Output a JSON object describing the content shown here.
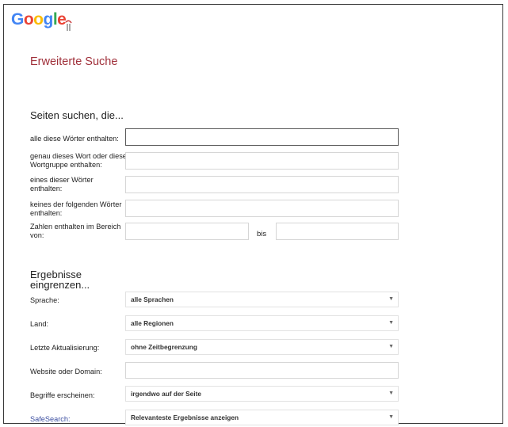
{
  "logo": {
    "text": "Google"
  },
  "page_title": "Erweiterte Suche",
  "find_pages": {
    "heading": "Seiten suchen, die...",
    "rows": [
      {
        "label": "alle diese Wörter enthalten:",
        "value": ""
      },
      {
        "label": "genau dieses Wort oder diese Wortgruppe enthalten:",
        "value": ""
      },
      {
        "label": "eines dieser Wörter enthalten:",
        "value": ""
      },
      {
        "label": "keines der folgenden Wörter enthalten:",
        "value": ""
      },
      {
        "label": "Zahlen enthalten im Bereich von:",
        "value_from": "",
        "value_to": ""
      }
    ],
    "range_separator": "bis"
  },
  "narrow": {
    "heading_line1": "Ergebnisse",
    "heading_line2": "eingrenzen...",
    "rows": [
      {
        "label": "Sprache:",
        "value": "alle Sprachen",
        "type": "select"
      },
      {
        "label": "Land:",
        "value": "alle Regionen",
        "type": "select"
      },
      {
        "label": "Letzte Aktualisierung:",
        "value": "ohne Zeitbegrenzung",
        "type": "select"
      },
      {
        "label": "Website oder Domain:",
        "value": "",
        "type": "input"
      },
      {
        "label": "Begriffe erscheinen:",
        "value": "irgendwo auf der Seite",
        "type": "select"
      },
      {
        "label": "SafeSearch:",
        "value": "Relevanteste Ergebnisse anzeigen",
        "type": "select"
      }
    ]
  },
  "colors": {
    "title": "#a0303a",
    "safesearch_link": "#3b4ea0",
    "logo_g": "#4285f4",
    "logo_o1": "#ea4335",
    "logo_o2": "#fbbc05",
    "logo_l": "#34a853",
    "logo_e": "#ea4335"
  },
  "icons": {
    "select_caret": "chevron-down-icon",
    "doodle": "doodle-mark-icon"
  }
}
